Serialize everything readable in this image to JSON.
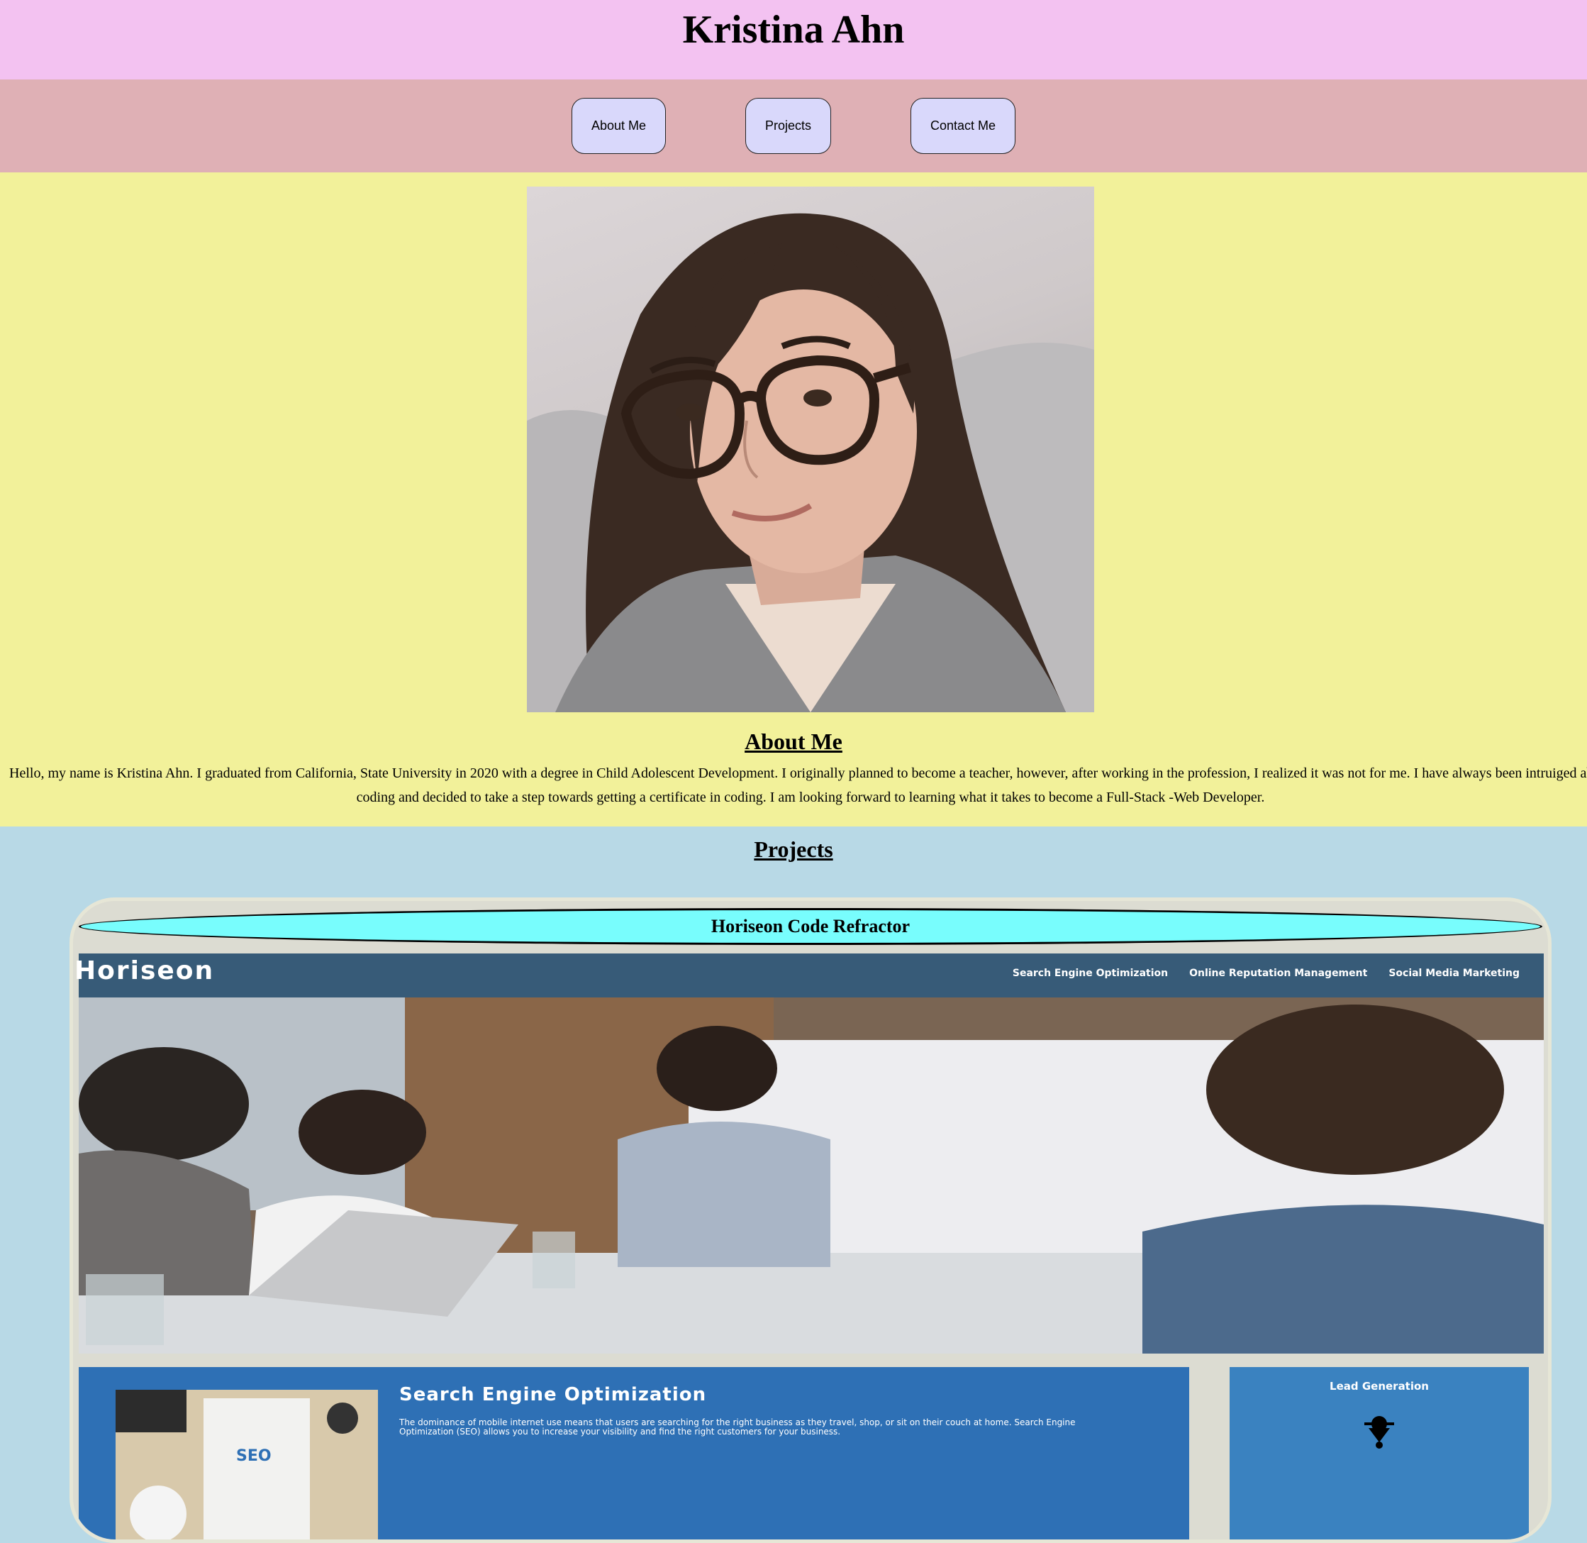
{
  "header": {
    "title": "Kristina Ahn"
  },
  "nav": {
    "about": "About Me",
    "projects": "Projects",
    "contact": "Contact Me"
  },
  "about": {
    "heading": "About Me",
    "body": "Hello, my name is Kristina Ahn. I graduated from California, State University in 2020 with a degree in Child Adolescent Development. I originally planned to become a teacher, however, after working in the profession, I realized it was not for me. I have always been intruiged about coding and decided to take a step towards getting a certificate in coding. I am looking forward to learning what it takes to become a Full-Stack -Web Developer."
  },
  "projects": {
    "heading": "Projects",
    "cards": [
      {
        "title": "Horiseon Code Refractor",
        "screenshot": {
          "logo": "Horiseon",
          "nav": [
            "Search Engine Optimization",
            "Online Reputation Management",
            "Social Media Marketing"
          ],
          "seo_title": "Search Engine Optimization",
          "seo_text": "The dominance of mobile internet use means that users are searching for the right business as they travel, shop, or sit on their couch at home. Search Engine Optimization (SEO) allows you to increase your visibility and find the right customers for your business.",
          "seo_image_label": "SEO",
          "side_title": "Lead Generation"
        }
      }
    ]
  },
  "colors": {
    "header_bg": "#f3c2f1",
    "nav_bg": "#dfb0b5",
    "button_bg": "#d9d8fb",
    "about_bg": "#f2f19a",
    "projects_bg": "#b8d9e6",
    "card_title_bg": "#78fdfd",
    "horiseon_bar": "#375b78",
    "horiseon_blue": "#2e70b5"
  }
}
